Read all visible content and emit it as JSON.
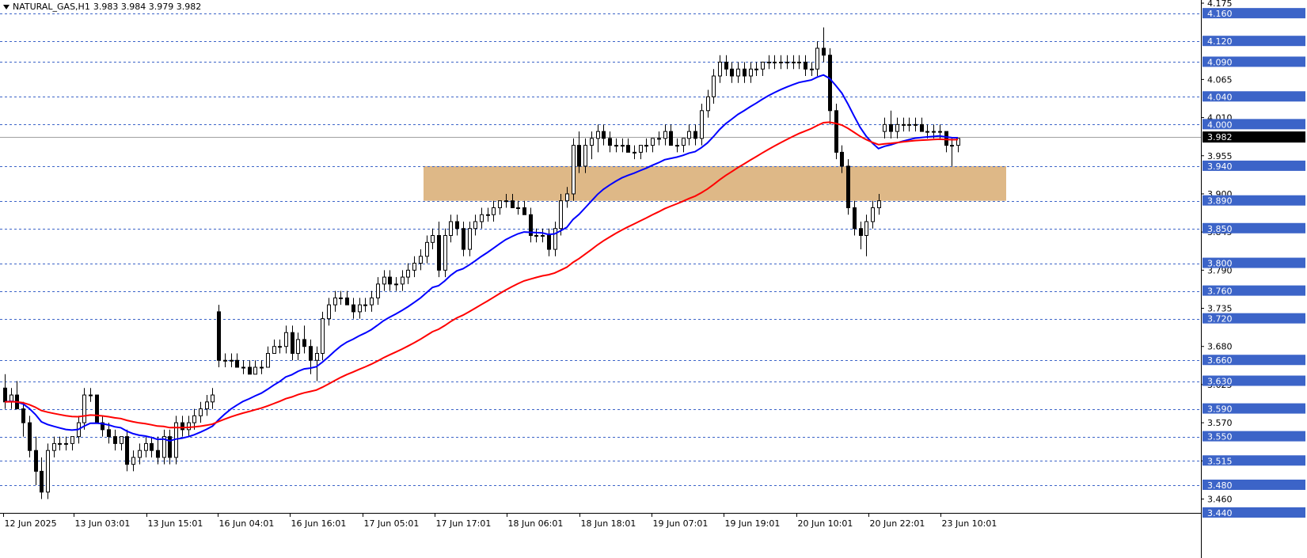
{
  "header": {
    "title": "NATURAL_GAS,H1",
    "ohlc": "3.983 3.984 3.979 3.982"
  },
  "colors": {
    "bull_body": "#ffffff",
    "bear_body": "#000000",
    "wick": "#000000",
    "ma_fast": "#0000ff",
    "ma_slow": "#ff0000",
    "zone": "#deb887",
    "level_line": "#3c64c8",
    "level_label_bg": "#3c64c8",
    "current_label_bg": "#000000"
  },
  "chart_data": {
    "type": "candlestick",
    "symbol": "NATURAL_GAS",
    "timeframe": "H1",
    "ylim": [
      3.44,
      4.175
    ],
    "grid": false,
    "y_ticks": [
      "4.175",
      "4.065",
      "4.010",
      "3.955",
      "3.900",
      "3.845",
      "3.790",
      "3.735",
      "3.680",
      "3.625",
      "3.570",
      "3.515",
      "3.460"
    ],
    "horizontal_levels": [
      "4.160",
      "4.120",
      "4.090",
      "4.040",
      "4.000",
      "3.940",
      "3.890",
      "3.850",
      "3.800",
      "3.760",
      "3.720",
      "3.660",
      "3.630",
      "3.590",
      "3.550",
      "3.515",
      "3.480",
      "3.440"
    ],
    "current_price": "3.982",
    "zone": {
      "from": 3.89,
      "to": 3.94
    },
    "x_labels": [
      "12 Jun 2025",
      "13 Jun 03:01",
      "13 Jun 15:01",
      "16 Jun 04:01",
      "16 Jun 16:01",
      "17 Jun 05:01",
      "17 Jun 17:01",
      "18 Jun 06:01",
      "18 Jun 18:01",
      "19 Jun 07:01",
      "19 Jun 19:01",
      "20 Jun 10:01",
      "20 Jun 22:01",
      "23 Jun 10:01"
    ],
    "candles": [
      [
        3.62,
        3.64,
        3.59,
        3.6
      ],
      [
        3.6,
        3.62,
        3.59,
        3.61
      ],
      [
        3.61,
        3.63,
        3.59,
        3.59
      ],
      [
        3.59,
        3.6,
        3.55,
        3.57
      ],
      [
        3.57,
        3.58,
        3.52,
        3.53
      ],
      [
        3.53,
        3.55,
        3.48,
        3.5
      ],
      [
        3.5,
        3.52,
        3.46,
        3.47
      ],
      [
        3.47,
        3.54,
        3.46,
        3.53
      ],
      [
        3.53,
        3.55,
        3.52,
        3.54
      ],
      [
        3.54,
        3.55,
        3.53,
        3.54
      ],
      [
        3.54,
        3.55,
        3.53,
        3.54
      ],
      [
        3.54,
        3.55,
        3.53,
        3.55
      ],
      [
        3.55,
        3.58,
        3.54,
        3.57
      ],
      [
        3.57,
        3.62,
        3.56,
        3.61
      ],
      [
        3.61,
        3.62,
        3.6,
        3.61
      ],
      [
        3.61,
        3.61,
        3.57,
        3.57
      ],
      [
        3.57,
        3.58,
        3.55,
        3.56
      ],
      [
        3.56,
        3.57,
        3.54,
        3.55
      ],
      [
        3.55,
        3.56,
        3.53,
        3.54
      ],
      [
        3.54,
        3.55,
        3.53,
        3.55
      ],
      [
        3.55,
        3.56,
        3.5,
        3.51
      ],
      [
        3.51,
        3.53,
        3.5,
        3.52
      ],
      [
        3.52,
        3.54,
        3.51,
        3.53
      ],
      [
        3.53,
        3.55,
        3.52,
        3.54
      ],
      [
        3.54,
        3.55,
        3.52,
        3.53
      ],
      [
        3.53,
        3.55,
        3.51,
        3.52
      ],
      [
        3.52,
        3.56,
        3.51,
        3.55
      ],
      [
        3.55,
        3.56,
        3.51,
        3.52
      ],
      [
        3.52,
        3.58,
        3.51,
        3.57
      ],
      [
        3.57,
        3.58,
        3.55,
        3.56
      ],
      [
        3.56,
        3.58,
        3.55,
        3.57
      ],
      [
        3.57,
        3.59,
        3.56,
        3.58
      ],
      [
        3.58,
        3.6,
        3.57,
        3.59
      ],
      [
        3.59,
        3.61,
        3.58,
        3.6
      ],
      [
        3.6,
        3.62,
        3.59,
        3.61
      ],
      [
        3.73,
        3.74,
        3.65,
        3.66
      ],
      [
        3.66,
        3.67,
        3.65,
        3.66
      ],
      [
        3.66,
        3.67,
        3.65,
        3.66
      ],
      [
        3.66,
        3.67,
        3.65,
        3.65
      ],
      [
        3.65,
        3.66,
        3.64,
        3.65
      ],
      [
        3.65,
        3.66,
        3.64,
        3.64
      ],
      [
        3.64,
        3.66,
        3.64,
        3.65
      ],
      [
        3.65,
        3.66,
        3.64,
        3.65
      ],
      [
        3.65,
        3.68,
        3.65,
        3.67
      ],
      [
        3.67,
        3.69,
        3.67,
        3.68
      ],
      [
        3.68,
        3.69,
        3.67,
        3.68
      ],
      [
        3.68,
        3.71,
        3.67,
        3.7
      ],
      [
        3.7,
        3.71,
        3.66,
        3.67
      ],
      [
        3.67,
        3.7,
        3.66,
        3.69
      ],
      [
        3.69,
        3.71,
        3.67,
        3.68
      ],
      [
        3.68,
        3.69,
        3.64,
        3.66
      ],
      [
        3.66,
        3.68,
        3.63,
        3.67
      ],
      [
        3.67,
        3.73,
        3.66,
        3.72
      ],
      [
        3.72,
        3.75,
        3.71,
        3.74
      ],
      [
        3.74,
        3.76,
        3.73,
        3.75
      ],
      [
        3.75,
        3.76,
        3.74,
        3.75
      ],
      [
        3.75,
        3.76,
        3.74,
        3.74
      ],
      [
        3.74,
        3.75,
        3.72,
        3.73
      ],
      [
        3.73,
        3.75,
        3.72,
        3.74
      ],
      [
        3.74,
        3.75,
        3.73,
        3.74
      ],
      [
        3.74,
        3.76,
        3.73,
        3.75
      ],
      [
        3.75,
        3.78,
        3.74,
        3.77
      ],
      [
        3.77,
        3.79,
        3.76,
        3.78
      ],
      [
        3.78,
        3.79,
        3.76,
        3.77
      ],
      [
        3.77,
        3.78,
        3.76,
        3.77
      ],
      [
        3.77,
        3.79,
        3.76,
        3.78
      ],
      [
        3.78,
        3.8,
        3.77,
        3.79
      ],
      [
        3.79,
        3.81,
        3.78,
        3.8
      ],
      [
        3.8,
        3.82,
        3.79,
        3.81
      ],
      [
        3.81,
        3.84,
        3.8,
        3.83
      ],
      [
        3.83,
        3.85,
        3.82,
        3.84
      ],
      [
        3.84,
        3.86,
        3.78,
        3.79
      ],
      [
        3.79,
        3.85,
        3.78,
        3.84
      ],
      [
        3.84,
        3.87,
        3.83,
        3.86
      ],
      [
        3.86,
        3.87,
        3.84,
        3.85
      ],
      [
        3.85,
        3.86,
        3.81,
        3.82
      ],
      [
        3.82,
        3.86,
        3.81,
        3.85
      ],
      [
        3.85,
        3.87,
        3.84,
        3.86
      ],
      [
        3.86,
        3.88,
        3.85,
        3.87
      ],
      [
        3.87,
        3.88,
        3.86,
        3.87
      ],
      [
        3.87,
        3.89,
        3.86,
        3.88
      ],
      [
        3.88,
        3.89,
        3.87,
        3.89
      ],
      [
        3.89,
        3.9,
        3.88,
        3.89
      ],
      [
        3.89,
        3.9,
        3.88,
        3.88
      ],
      [
        3.88,
        3.89,
        3.87,
        3.88
      ],
      [
        3.88,
        3.89,
        3.87,
        3.87
      ],
      [
        3.87,
        3.88,
        3.83,
        3.84
      ],
      [
        3.84,
        3.85,
        3.83,
        3.84
      ],
      [
        3.84,
        3.85,
        3.83,
        3.84
      ],
      [
        3.84,
        3.85,
        3.81,
        3.82
      ],
      [
        3.82,
        3.86,
        3.81,
        3.85
      ],
      [
        3.85,
        3.9,
        3.84,
        3.89
      ],
      [
        3.89,
        3.91,
        3.88,
        3.9
      ],
      [
        3.9,
        3.98,
        3.89,
        3.97
      ],
      [
        3.97,
        3.99,
        3.93,
        3.94
      ],
      [
        3.94,
        3.98,
        3.93,
        3.97
      ],
      [
        3.97,
        3.99,
        3.95,
        3.98
      ],
      [
        3.98,
        4.0,
        3.96,
        3.99
      ],
      [
        3.99,
        4.0,
        3.97,
        3.98
      ],
      [
        3.98,
        3.99,
        3.96,
        3.97
      ],
      [
        3.97,
        3.98,
        3.96,
        3.97
      ],
      [
        3.97,
        3.98,
        3.96,
        3.97
      ],
      [
        3.97,
        3.98,
        3.96,
        3.96
      ],
      [
        3.96,
        3.97,
        3.95,
        3.96
      ],
      [
        3.96,
        3.97,
        3.95,
        3.97
      ],
      [
        3.97,
        3.98,
        3.96,
        3.97
      ],
      [
        3.97,
        3.98,
        3.96,
        3.98
      ],
      [
        3.98,
        3.99,
        3.97,
        3.98
      ],
      [
        3.98,
        4.0,
        3.97,
        3.99
      ],
      [
        3.99,
        4.0,
        3.97,
        3.97
      ],
      [
        3.97,
        3.98,
        3.96,
        3.97
      ],
      [
        3.97,
        3.98,
        3.96,
        3.98
      ],
      [
        3.98,
        4.0,
        3.97,
        3.99
      ],
      [
        3.99,
        4.0,
        3.97,
        3.98
      ],
      [
        3.98,
        4.03,
        3.97,
        4.02
      ],
      [
        4.02,
        4.05,
        4.01,
        4.04
      ],
      [
        4.04,
        4.08,
        4.03,
        4.07
      ],
      [
        4.07,
        4.1,
        4.06,
        4.09
      ],
      [
        4.09,
        4.1,
        4.07,
        4.08
      ],
      [
        4.08,
        4.09,
        4.06,
        4.07
      ],
      [
        4.07,
        4.09,
        4.06,
        4.08
      ],
      [
        4.08,
        4.09,
        4.06,
        4.07
      ],
      [
        4.07,
        4.09,
        4.06,
        4.08
      ],
      [
        4.08,
        4.09,
        4.07,
        4.08
      ],
      [
        4.08,
        4.09,
        4.07,
        4.09
      ],
      [
        4.09,
        4.1,
        4.08,
        4.09
      ],
      [
        4.09,
        4.1,
        4.08,
        4.09
      ],
      [
        4.09,
        4.1,
        4.08,
        4.09
      ],
      [
        4.09,
        4.1,
        4.08,
        4.09
      ],
      [
        4.09,
        4.1,
        4.08,
        4.09
      ],
      [
        4.09,
        4.1,
        4.08,
        4.09
      ],
      [
        4.09,
        4.1,
        4.07,
        4.08
      ],
      [
        4.08,
        4.09,
        4.07,
        4.08
      ],
      [
        4.08,
        4.12,
        4.07,
        4.11
      ],
      [
        4.11,
        4.14,
        4.09,
        4.1
      ],
      [
        4.1,
        4.11,
        4.0,
        4.02
      ],
      [
        4.02,
        4.03,
        3.95,
        3.96
      ],
      [
        3.96,
        3.97,
        3.93,
        3.94
      ],
      [
        3.94,
        3.95,
        3.87,
        3.88
      ],
      [
        3.88,
        3.89,
        3.84,
        3.85
      ],
      [
        3.85,
        3.86,
        3.82,
        3.84
      ],
      [
        3.84,
        3.87,
        3.81,
        3.86
      ],
      [
        3.86,
        3.89,
        3.85,
        3.88
      ],
      [
        3.88,
        3.9,
        3.87,
        3.89
      ],
      [
        3.99,
        4.01,
        3.98,
        4.0
      ],
      [
        4.0,
        4.02,
        3.98,
        3.99
      ],
      [
        3.99,
        4.01,
        3.98,
        4.0
      ],
      [
        4.0,
        4.01,
        3.99,
        4.0
      ],
      [
        4.0,
        4.01,
        3.99,
        4.0
      ],
      [
        4.0,
        4.01,
        3.99,
        4.0
      ],
      [
        4.0,
        4.01,
        3.99,
        3.99
      ],
      [
        3.99,
        4.0,
        3.98,
        3.99
      ],
      [
        3.99,
        4.0,
        3.98,
        3.99
      ],
      [
        3.99,
        4.0,
        3.98,
        3.99
      ],
      [
        3.99,
        3.99,
        3.96,
        3.97
      ],
      [
        3.97,
        3.98,
        3.94,
        3.97
      ],
      [
        3.97,
        3.98,
        3.96,
        3.98
      ]
    ]
  }
}
